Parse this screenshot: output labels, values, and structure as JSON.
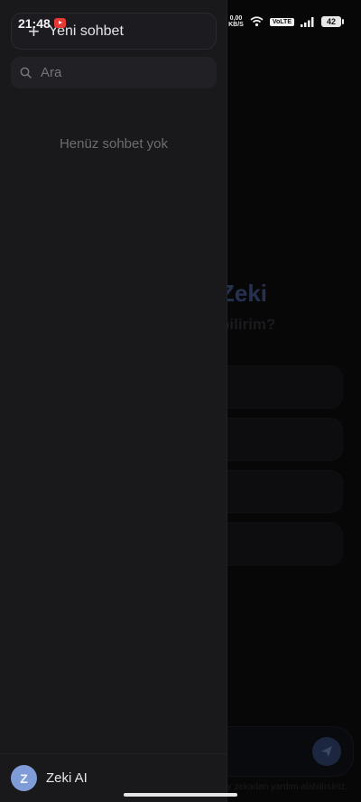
{
  "status_bar": {
    "time": "21:48",
    "net_speed_value": "0,00",
    "net_speed_unit": "KB/S",
    "volte": "VoLTE",
    "battery": "42",
    "notification_icon": "youtube-icon"
  },
  "drawer": {
    "new_chat_label": "Yeni sohbet",
    "new_chat_icon": "plus-icon",
    "search_placeholder": "Ara",
    "empty_text": "Henüz sohbet yok",
    "profile": {
      "initial": "Z",
      "name": "Zeki AI"
    }
  },
  "background": {
    "hero_title": "Zeki",
    "hero_subtitle": "abilirim?",
    "footnote": "yapay zekadan yardım alabilirsiniz."
  },
  "colors": {
    "drawer_bg": "#19191c",
    "avatar_bg": "#7f9bd8",
    "accent": "#3a4c78"
  }
}
